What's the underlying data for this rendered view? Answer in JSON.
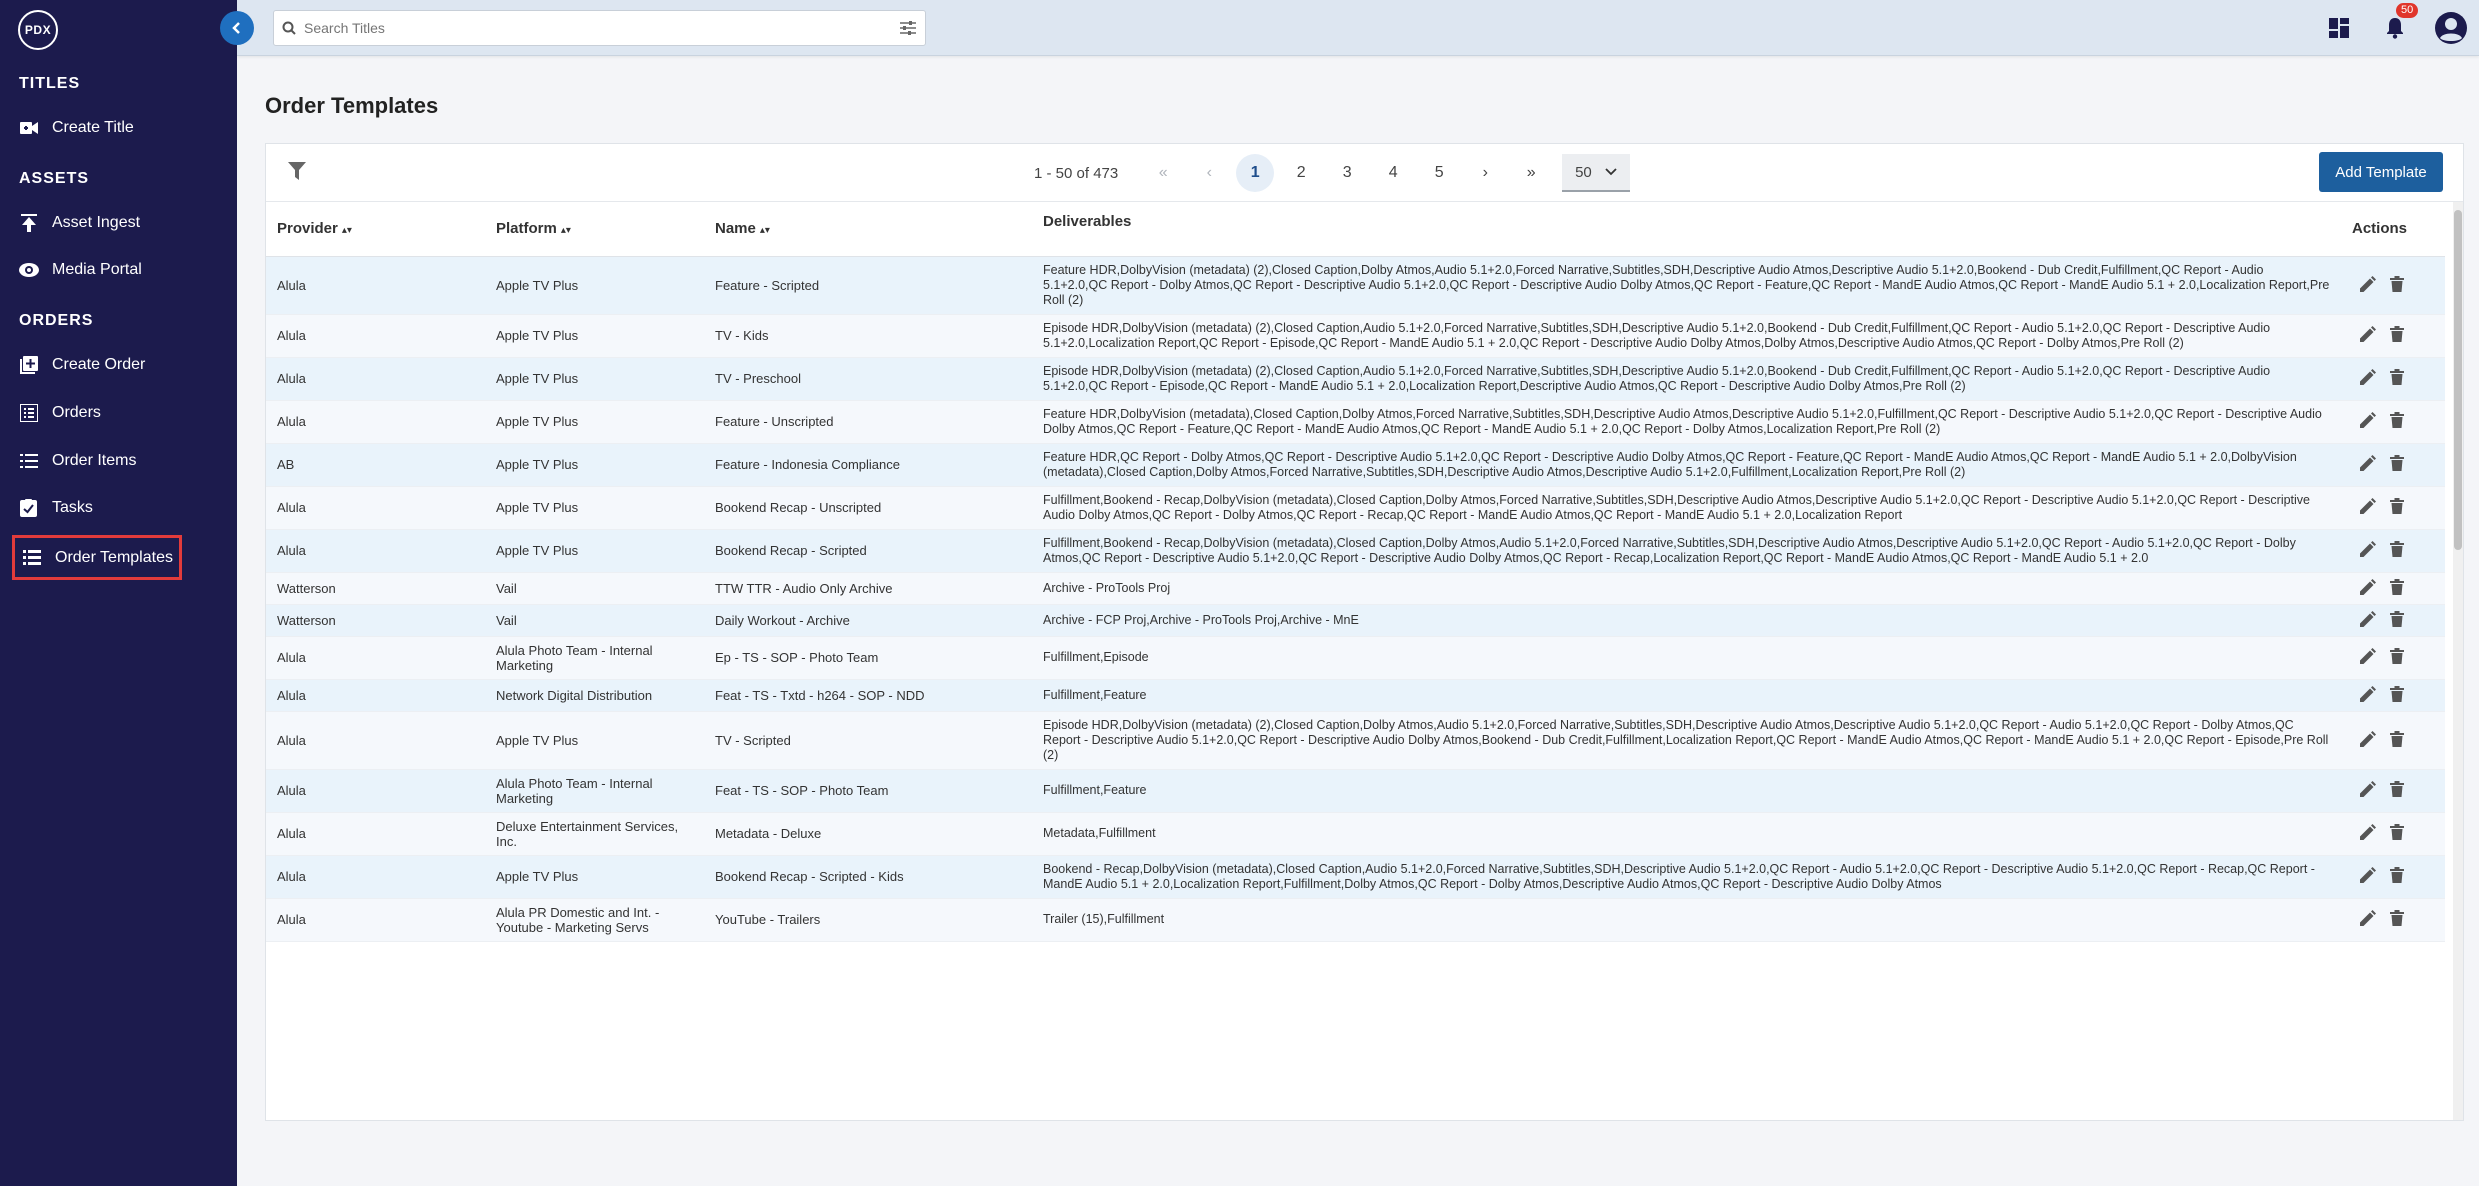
{
  "app": {
    "logo_text": "PDX"
  },
  "sidebar": {
    "sections": [
      {
        "title": "TITLES",
        "items": [
          {
            "label": "Create Title",
            "icon": "video-plus-icon"
          }
        ]
      },
      {
        "title": "ASSETS",
        "items": [
          {
            "label": "Asset Ingest",
            "icon": "upload-icon"
          },
          {
            "label": "Media Portal",
            "icon": "eye-icon"
          }
        ]
      },
      {
        "title": "ORDERS",
        "items": [
          {
            "label": "Create Order",
            "icon": "add-box-icon"
          },
          {
            "label": "Orders",
            "icon": "list-box-icon"
          },
          {
            "label": "Order Items",
            "icon": "list-icon"
          },
          {
            "label": "Tasks",
            "icon": "checkbox-icon"
          },
          {
            "label": "Order Templates",
            "icon": "table-list-icon",
            "active": true
          }
        ]
      }
    ]
  },
  "search": {
    "placeholder": "Search Titles",
    "value": ""
  },
  "topbar": {
    "notifications_count": "50"
  },
  "page": {
    "title": "Order Templates"
  },
  "toolbar": {
    "range_text": "1 - 50 of 473",
    "pages": [
      "1",
      "2",
      "3",
      "4",
      "5"
    ],
    "current_page": "1",
    "first": "«",
    "prev": "‹",
    "next": "›",
    "last": "»",
    "page_size": "50",
    "add_label": "Add Template"
  },
  "table": {
    "columns": [
      "Provider",
      "Platform",
      "Name",
      "Deliverables",
      "Actions"
    ],
    "rows": [
      {
        "provider": "Alula",
        "platform": "Apple TV Plus",
        "name": "Feature - Scripted",
        "deliverables": "Feature HDR,DolbyVision (metadata) (2),Closed Caption,Dolby Atmos,Audio 5.1+2.0,Forced Narrative,Subtitles,SDH,Descriptive Audio Atmos,Descriptive Audio 5.1+2.0,Bookend - Dub Credit,Fulfillment,QC Report - Audio 5.1+2.0,QC Report - Dolby Atmos,QC Report - Descriptive Audio 5.1+2.0,QC Report - Descriptive Audio Dolby Atmos,QC Report - Feature,QC Report - MandE Audio Atmos,QC Report - MandE Audio 5.1 + 2.0,Localization Report,Pre Roll (2)"
      },
      {
        "provider": "Alula",
        "platform": "Apple TV Plus",
        "name": "TV - Kids",
        "deliverables": "Episode HDR,DolbyVision (metadata) (2),Closed Caption,Audio 5.1+2.0,Forced Narrative,Subtitles,SDH,Descriptive Audio 5.1+2.0,Bookend - Dub Credit,Fulfillment,QC Report - Audio 5.1+2.0,QC Report - Descriptive Audio 5.1+2.0,Localization Report,QC Report - Episode,QC Report - MandE Audio 5.1 + 2.0,QC Report - Descriptive Audio Dolby Atmos,Dolby Atmos,Descriptive Audio Atmos,QC Report - Dolby Atmos,Pre Roll (2)"
      },
      {
        "provider": "Alula",
        "platform": "Apple TV Plus",
        "name": "TV - Preschool",
        "deliverables": "Episode HDR,DolbyVision (metadata) (2),Closed Caption,Audio 5.1+2.0,Forced Narrative,Subtitles,SDH,Descriptive Audio 5.1+2.0,Bookend - Dub Credit,Fulfillment,QC Report - Audio 5.1+2.0,QC Report - Descriptive Audio 5.1+2.0,QC Report - Episode,QC Report - MandE Audio 5.1 + 2.0,Localization Report,Descriptive Audio Atmos,QC Report - Descriptive Audio Dolby Atmos,Pre Roll (2)"
      },
      {
        "provider": "Alula",
        "platform": "Apple TV Plus",
        "name": "Feature - Unscripted",
        "deliverables": "Feature HDR,DolbyVision (metadata),Closed Caption,Dolby Atmos,Forced Narrative,Subtitles,SDH,Descriptive Audio Atmos,Descriptive Audio 5.1+2.0,Fulfillment,QC Report - Descriptive Audio 5.1+2.0,QC Report - Descriptive Audio Dolby Atmos,QC Report - Feature,QC Report - MandE Audio Atmos,QC Report - MandE Audio 5.1 + 2.0,QC Report - Dolby Atmos,Localization Report,Pre Roll (2)"
      },
      {
        "provider": "AB",
        "platform": "Apple TV Plus",
        "name": "Feature - Indonesia Compliance",
        "deliverables": "Feature HDR,QC Report - Dolby Atmos,QC Report - Descriptive Audio 5.1+2.0,QC Report - Descriptive Audio Dolby Atmos,QC Report - Feature,QC Report - MandE Audio Atmos,QC Report - MandE Audio 5.1 + 2.0,DolbyVision (metadata),Closed Caption,Dolby Atmos,Forced Narrative,Subtitles,SDH,Descriptive Audio Atmos,Descriptive Audio 5.1+2.0,Fulfillment,Localization Report,Pre Roll (2)"
      },
      {
        "provider": "Alula",
        "platform": "Apple TV Plus",
        "name": "Bookend Recap - Unscripted",
        "deliverables": "Fulfillment,Bookend - Recap,DolbyVision (metadata),Closed Caption,Dolby Atmos,Forced Narrative,Subtitles,SDH,Descriptive Audio Atmos,Descriptive Audio 5.1+2.0,QC Report - Descriptive Audio 5.1+2.0,QC Report - Descriptive Audio Dolby Atmos,QC Report - Dolby Atmos,QC Report - Recap,QC Report - MandE Audio Atmos,QC Report - MandE Audio 5.1 + 2.0,Localization Report"
      },
      {
        "provider": "Alula",
        "platform": "Apple TV Plus",
        "name": "Bookend Recap - Scripted",
        "deliverables": "Fulfillment,Bookend - Recap,DolbyVision (metadata),Closed Caption,Dolby Atmos,Audio 5.1+2.0,Forced Narrative,Subtitles,SDH,Descriptive Audio Atmos,Descriptive Audio 5.1+2.0,QC Report - Audio 5.1+2.0,QC Report - Dolby Atmos,QC Report - Descriptive Audio 5.1+2.0,QC Report - Descriptive Audio Dolby Atmos,QC Report - Recap,Localization Report,QC Report - MandE Audio Atmos,QC Report - MandE Audio 5.1 + 2.0"
      },
      {
        "provider": "Watterson",
        "platform": "Vail",
        "name": "TTW TTR - Audio Only Archive",
        "deliverables": "Archive - ProTools Proj"
      },
      {
        "provider": "Watterson",
        "platform": "Vail",
        "name": "Daily Workout - Archive",
        "deliverables": "Archive - FCP Proj,Archive - ProTools Proj,Archive - MnE"
      },
      {
        "provider": "Alula",
        "platform": "Alula Photo Team - Internal Marketing",
        "name": "Ep - TS - SOP - Photo Team",
        "deliverables": "Fulfillment,Episode"
      },
      {
        "provider": "Alula",
        "platform": "Network Digital Distribution",
        "name": "Feat - TS - Txtd - h264 - SOP - NDD",
        "deliverables": "Fulfillment,Feature"
      },
      {
        "provider": "Alula",
        "platform": "Apple TV Plus",
        "name": "TV - Scripted",
        "deliverables": "Episode HDR,DolbyVision (metadata) (2),Closed Caption,Dolby Atmos,Audio 5.1+2.0,Forced Narrative,Subtitles,SDH,Descriptive Audio Atmos,Descriptive Audio 5.1+2.0,QC Report - Audio 5.1+2.0,QC Report - Dolby Atmos,QC Report - Descriptive Audio 5.1+2.0,QC Report - Descriptive Audio Dolby Atmos,Bookend - Dub Credit,Fulfillment,Localization Report,QC Report - MandE Audio Atmos,QC Report - MandE Audio 5.1 + 2.0,QC Report - Episode,Pre Roll (2)"
      },
      {
        "provider": "Alula",
        "platform": "Alula Photo Team - Internal Marketing",
        "name": "Feat - TS - SOP - Photo Team",
        "deliverables": "Fulfillment,Feature"
      },
      {
        "provider": "Alula",
        "platform": "Deluxe Entertainment Services, Inc.",
        "name": "Metadata - Deluxe",
        "deliverables": "Metadata,Fulfillment"
      },
      {
        "provider": "Alula",
        "platform": "Apple TV Plus",
        "name": "Bookend Recap - Scripted - Kids",
        "deliverables": "Bookend - Recap,DolbyVision (metadata),Closed Caption,Audio 5.1+2.0,Forced Narrative,Subtitles,SDH,Descriptive Audio 5.1+2.0,QC Report - Audio 5.1+2.0,QC Report - Descriptive Audio 5.1+2.0,QC Report - Recap,QC Report - MandE Audio 5.1 + 2.0,Localization Report,Fulfillment,Dolby Atmos,QC Report - Dolby Atmos,Descriptive Audio Atmos,QC Report - Descriptive Audio Dolby Atmos"
      },
      {
        "provider": "Alula",
        "platform": "Alula PR Domestic and Int. - Youtube - Marketing Servs",
        "name": "YouTube - Trailers",
        "deliverables": "Trailer (15),Fulfillment"
      }
    ]
  },
  "colors": {
    "sidebar_bg": "#1c1b4d",
    "accent": "#1d5f9e",
    "active_outline": "#e23b3b",
    "row_alt": "#e9f3fb"
  }
}
